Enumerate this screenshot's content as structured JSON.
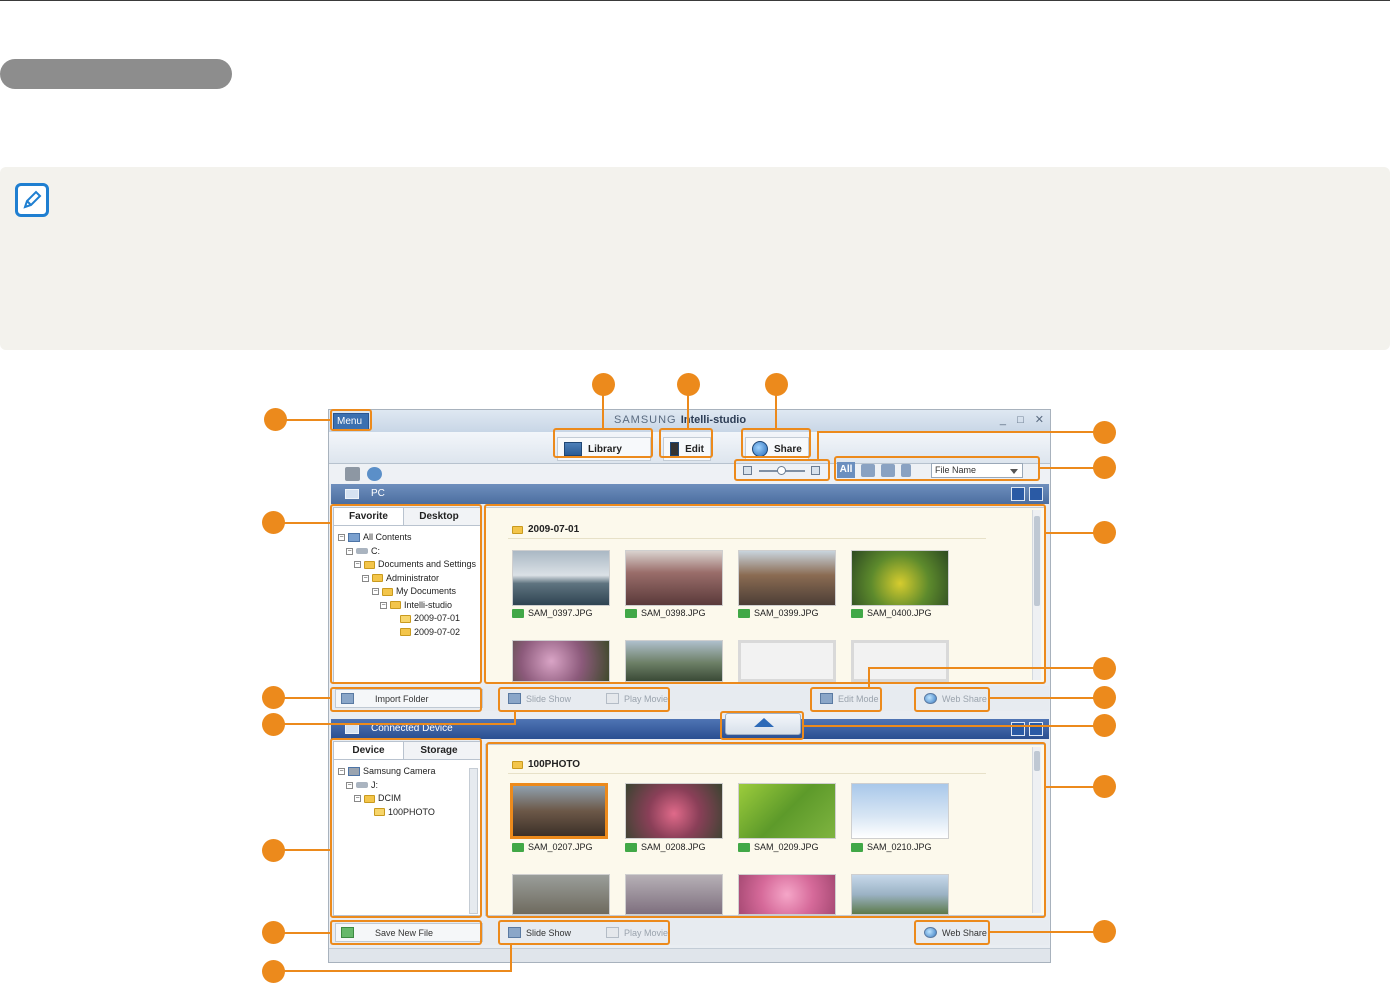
{
  "app": {
    "menu_label": "Menu",
    "brand_prefix": "SAMSUNG",
    "brand_name": "Intelli-studio",
    "win_controls": "_ □ ✕",
    "mode_buttons": {
      "library": "Library",
      "edit": "Edit",
      "share": "Share"
    },
    "filter_all": "All",
    "sort_by": "File Name"
  },
  "pc_pane": {
    "title": "PC",
    "tabs": [
      "Favorite",
      "Desktop"
    ],
    "tree": [
      "All Contents",
      "C:",
      "Documents and Settings",
      "Administrator",
      "My Documents",
      "Intelli-studio",
      "2009-07-01",
      "2009-07-02"
    ],
    "folder_title": "2009-07-01",
    "thumbs": [
      "SAM_0397.JPG",
      "SAM_0398.JPG",
      "SAM_0399.JPG",
      "SAM_0400.JPG"
    ],
    "import_label": "Import Folder",
    "slide_show": "Slide Show",
    "play_movie": "Play Movie",
    "edit_mode": "Edit Mode",
    "web_share": "Web Share"
  },
  "device_pane": {
    "title": "Connected Device",
    "tabs": [
      "Device",
      "Storage"
    ],
    "tree": [
      "Samsung Camera",
      "J:",
      "DCIM",
      "100PHOTO"
    ],
    "folder_title": "100PHOTO",
    "thumbs": [
      "SAM_0207.JPG",
      "SAM_0208.JPG",
      "SAM_0209.JPG",
      "SAM_0210.JPG"
    ],
    "save_label": "Save New File",
    "slide_show": "Slide Show",
    "play_movie": "Play Movie",
    "web_share": "Web Share"
  },
  "colors": {
    "callout": "#ec8a1c",
    "note_bg": "#f3f2ed",
    "accent_blue": "#1f7fd1"
  }
}
